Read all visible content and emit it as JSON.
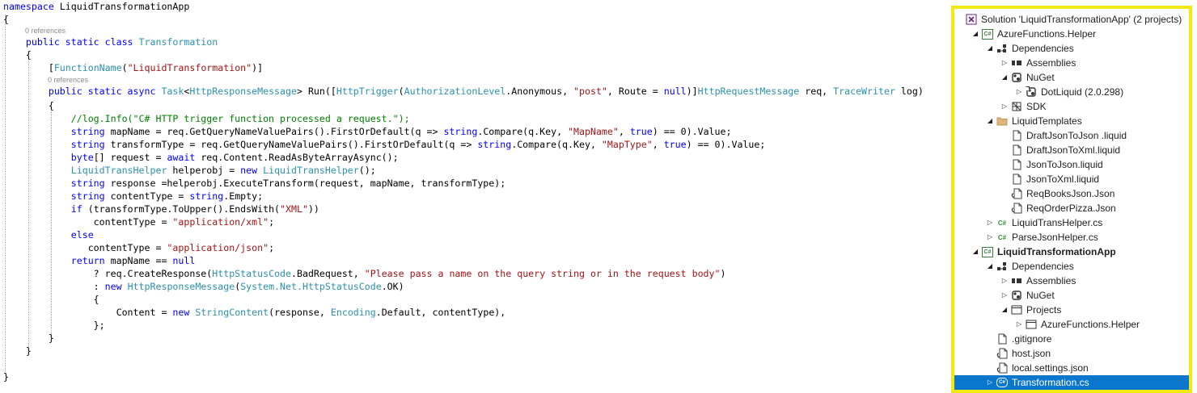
{
  "editor": {
    "lines": [
      {
        "tokens": [
          [
            "kw",
            "namespace"
          ],
          [
            "pl",
            " LiquidTransformationApp"
          ]
        ]
      },
      {
        "tokens": [
          [
            "pl",
            "{"
          ]
        ]
      },
      {
        "tokens": [
          [
            "kw",
            "    public static class"
          ],
          [
            "pl",
            " "
          ],
          [
            "ty",
            "Transformation"
          ]
        ]
      },
      {
        "tokens": [
          [
            "pl",
            "    {"
          ]
        ]
      },
      {
        "tokens": [
          [
            "pl",
            "        ["
          ],
          [
            "ty",
            "FunctionName"
          ],
          [
            "pl",
            "("
          ],
          [
            "str",
            "\"LiquidTransformation\""
          ],
          [
            "pl",
            ")]"
          ]
        ]
      },
      {
        "tokens": [
          [
            "kw",
            "        public static async"
          ],
          [
            "pl",
            " "
          ],
          [
            "ty",
            "Task"
          ],
          [
            "pl",
            "<"
          ],
          [
            "ty",
            "HttpResponseMessage"
          ],
          [
            "pl",
            "> Run(["
          ],
          [
            "ty",
            "HttpTrigger"
          ],
          [
            "pl",
            "("
          ],
          [
            "ty",
            "AuthorizationLevel"
          ],
          [
            "pl",
            ".Anonymous, "
          ],
          [
            "str",
            "\"post\""
          ],
          [
            "pl",
            ", Route = "
          ],
          [
            "kw",
            "null"
          ],
          [
            "pl",
            ")]"
          ],
          [
            "ty",
            "HttpRequestMessage"
          ],
          [
            "pl",
            " req, "
          ],
          [
            "ty",
            "TraceWriter"
          ],
          [
            "pl",
            " log)"
          ]
        ]
      },
      {
        "tokens": [
          [
            "pl",
            "        {"
          ]
        ]
      },
      {
        "tokens": [
          [
            "cm",
            "            //log.Info(\"C# HTTP trigger function processed a request.\");"
          ]
        ]
      },
      {
        "tokens": [
          [
            "kw",
            "            string"
          ],
          [
            "pl",
            " mapName = req.GetQueryNameValuePairs().FirstOrDefault(q => "
          ],
          [
            "kw",
            "string"
          ],
          [
            "pl",
            ".Compare(q.Key, "
          ],
          [
            "str",
            "\"MapName\""
          ],
          [
            "pl",
            ", "
          ],
          [
            "kw",
            "true"
          ],
          [
            "pl",
            ") == 0).Value;"
          ]
        ]
      },
      {
        "tokens": [
          [
            "kw",
            "            string"
          ],
          [
            "pl",
            " transformType = req.GetQueryNameValuePairs().FirstOrDefault(q => "
          ],
          [
            "kw",
            "string"
          ],
          [
            "pl",
            ".Compare(q.Key, "
          ],
          [
            "str",
            "\"MapType\""
          ],
          [
            "pl",
            ", "
          ],
          [
            "kw",
            "true"
          ],
          [
            "pl",
            ") == 0).Value;"
          ]
        ]
      },
      {
        "tokens": [
          [
            "kw",
            "            byte"
          ],
          [
            "pl",
            "[] request = "
          ],
          [
            "kw",
            "await"
          ],
          [
            "pl",
            " req.Content.ReadAsByteArrayAsync();"
          ]
        ]
      },
      {
        "tokens": [
          [
            "ty",
            "            LiquidTransHelper"
          ],
          [
            "pl",
            " helperobj = "
          ],
          [
            "kw",
            "new"
          ],
          [
            "pl",
            " "
          ],
          [
            "ty",
            "LiquidTransHelper"
          ],
          [
            "pl",
            "();"
          ]
        ]
      },
      {
        "tokens": [
          [
            "kw",
            "            string"
          ],
          [
            "pl",
            " response =helperobj.ExecuteTransform(request, mapName, transformType);"
          ]
        ]
      },
      {
        "tokens": [
          [
            "kw",
            "            string"
          ],
          [
            "pl",
            " contentType = "
          ],
          [
            "kw",
            "string"
          ],
          [
            "pl",
            ".Empty;"
          ]
        ]
      },
      {
        "tokens": [
          [
            "kw",
            "            if"
          ],
          [
            "pl",
            " (transformType.ToUpper().EndsWith("
          ],
          [
            "str",
            "\"XML\""
          ],
          [
            "pl",
            "))"
          ]
        ]
      },
      {
        "tokens": [
          [
            "pl",
            "                contentType = "
          ],
          [
            "str",
            "\"application/xml\""
          ],
          [
            "pl",
            ";"
          ]
        ]
      },
      {
        "tokens": [
          [
            "kw",
            "            else"
          ]
        ]
      },
      {
        "tokens": [
          [
            "pl",
            "               contentType = "
          ],
          [
            "str",
            "\"application/json\""
          ],
          [
            "pl",
            ";"
          ]
        ]
      },
      {
        "tokens": [
          [
            "kw",
            "            return"
          ],
          [
            "pl",
            " mapName == "
          ],
          [
            "kw",
            "null"
          ]
        ]
      },
      {
        "tokens": [
          [
            "pl",
            "                ? req.CreateResponse("
          ],
          [
            "ty",
            "HttpStatusCode"
          ],
          [
            "pl",
            ".BadRequest, "
          ],
          [
            "str",
            "\"Please pass a name on the query string or in the request body\""
          ],
          [
            "pl",
            ")"
          ]
        ]
      },
      {
        "tokens": [
          [
            "pl",
            "                : "
          ],
          [
            "kw",
            "new"
          ],
          [
            "pl",
            " "
          ],
          [
            "ty",
            "HttpResponseMessage"
          ],
          [
            "pl",
            "("
          ],
          [
            "ty",
            "System.Net.HttpStatusCode"
          ],
          [
            "pl",
            ".OK)"
          ]
        ]
      },
      {
        "tokens": [
          [
            "pl",
            "                {"
          ]
        ]
      },
      {
        "tokens": [
          [
            "pl",
            "                    Content = "
          ],
          [
            "kw",
            "new"
          ],
          [
            "pl",
            " "
          ],
          [
            "ty",
            "StringContent"
          ],
          [
            "pl",
            "(response, "
          ],
          [
            "ty",
            "Encoding"
          ],
          [
            "pl",
            ".Default, contentType),"
          ]
        ]
      },
      {
        "tokens": [
          [
            "pl",
            "                };"
          ]
        ]
      },
      {
        "tokens": [
          [
            "pl",
            "        }"
          ]
        ]
      },
      {
        "tokens": [
          [
            "pl",
            "    }"
          ]
        ]
      },
      {
        "tokens": [
          [
            "pl",
            ""
          ]
        ]
      },
      {
        "tokens": [
          [
            "pl",
            "}"
          ]
        ]
      }
    ],
    "code_lens": [
      "0 references",
      "0 references"
    ]
  },
  "solution_explorer": {
    "items": [
      {
        "label": "Solution 'LiquidTransformationApp' (2 projects)",
        "icon": "vs-solution-icon",
        "arrow": "",
        "bold": false,
        "selected": false
      },
      {
        "label": "AzureFunctions.Helper",
        "icon": "csharp-project-icon",
        "arrow": "expanded",
        "bold": false,
        "selected": false
      },
      {
        "label": "Dependencies",
        "icon": "dependencies-icon",
        "arrow": "expanded",
        "bold": false,
        "selected": false
      },
      {
        "label": "Assemblies",
        "icon": "assemblies-icon",
        "arrow": "collapsed",
        "bold": false,
        "selected": false
      },
      {
        "label": "NuGet",
        "icon": "nuget-icon",
        "arrow": "expanded",
        "bold": false,
        "selected": false
      },
      {
        "label": "DotLiquid (2.0.298)",
        "icon": "package-icon",
        "arrow": "collapsed",
        "bold": false,
        "selected": false
      },
      {
        "label": "SDK",
        "icon": "sdk-icon",
        "arrow": "collapsed",
        "bold": false,
        "selected": false
      },
      {
        "label": "LiquidTemplates",
        "icon": "folder-icon",
        "arrow": "expanded",
        "bold": false,
        "selected": false
      },
      {
        "label": "DraftJsonToJson .liquid",
        "icon": "file-icon",
        "arrow": "",
        "bold": false,
        "selected": false
      },
      {
        "label": "DraftJsonToXml.liquid",
        "icon": "file-icon",
        "arrow": "",
        "bold": false,
        "selected": false
      },
      {
        "label": "JsonToJson.liquid",
        "icon": "file-icon",
        "arrow": "",
        "bold": false,
        "selected": false
      },
      {
        "label": "JsonToXml.liquid",
        "icon": "file-icon",
        "arrow": "",
        "bold": false,
        "selected": false
      },
      {
        "label": "ReqBooksJson.Json",
        "icon": "json-file-icon",
        "arrow": "",
        "bold": false,
        "selected": false
      },
      {
        "label": "ReqOrderPizza.Json",
        "icon": "json-file-icon",
        "arrow": "",
        "bold": false,
        "selected": false
      },
      {
        "label": "LiquidTransHelper.cs",
        "icon": "csharp-file-icon",
        "arrow": "collapsed",
        "bold": false,
        "selected": false
      },
      {
        "label": "ParseJsonHelper.cs",
        "icon": "csharp-file-icon",
        "arrow": "collapsed",
        "bold": false,
        "selected": false
      },
      {
        "label": "LiquidTransformationApp",
        "icon": "csharp-project-icon",
        "arrow": "expanded",
        "bold": true,
        "selected": false
      },
      {
        "label": "Dependencies",
        "icon": "dependencies-icon",
        "arrow": "expanded",
        "bold": false,
        "selected": false
      },
      {
        "label": "Assemblies",
        "icon": "assemblies-icon",
        "arrow": "collapsed",
        "bold": false,
        "selected": false
      },
      {
        "label": "NuGet",
        "icon": "nuget-icon",
        "arrow": "collapsed",
        "bold": false,
        "selected": false
      },
      {
        "label": "Projects",
        "icon": "projects-icon",
        "arrow": "expanded",
        "bold": false,
        "selected": false
      },
      {
        "label": "AzureFunctions.Helper",
        "icon": "project-ref-icon",
        "arrow": "collapsed",
        "bold": false,
        "selected": false
      },
      {
        "label": ".gitignore",
        "icon": "file-icon",
        "arrow": "",
        "bold": false,
        "selected": false
      },
      {
        "label": "host.json",
        "icon": "json-file-icon",
        "arrow": "",
        "bold": false,
        "selected": false
      },
      {
        "label": "local.settings.json",
        "icon": "json-file-icon",
        "arrow": "",
        "bold": false,
        "selected": false
      },
      {
        "label": "Transformation.cs",
        "icon": "csharp-file-icon",
        "arrow": "collapsed",
        "bold": false,
        "selected": true
      }
    ]
  }
}
